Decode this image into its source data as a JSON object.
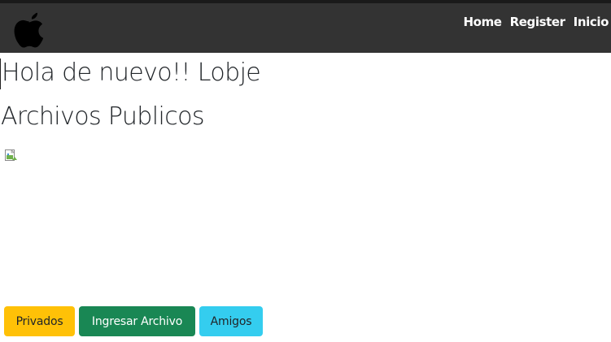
{
  "navbar": {
    "logo_icon": "apple-logo-icon",
    "links": [
      {
        "label": "Home"
      },
      {
        "label": "Register"
      },
      {
        "label": "Inicio"
      }
    ],
    "background": "#333333"
  },
  "main": {
    "greeting": "Hola de nuevo!! Lobje",
    "section_title": "Archivos Publicos",
    "image_icon": "broken-image-icon"
  },
  "actions": {
    "private_label": "Privados",
    "upload_label": "Ingresar Archivo",
    "friends_label": "Amigos",
    "colors": {
      "private": "#ffc107",
      "upload": "#198754",
      "friends": "#34cdef"
    }
  }
}
